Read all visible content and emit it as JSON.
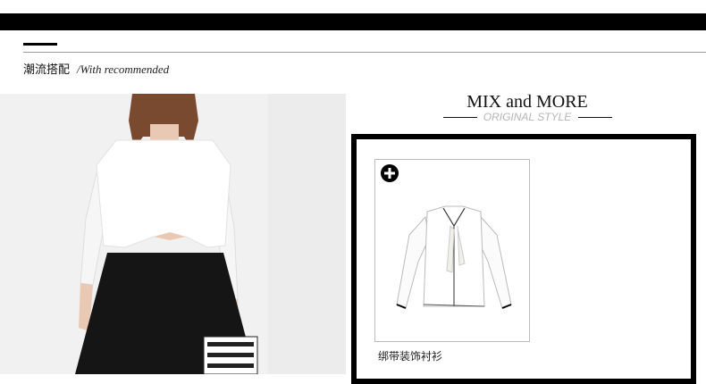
{
  "section": {
    "title": "潮流搭配",
    "subtitle": "/With recommended"
  },
  "mix": {
    "title": "MIX and MORE",
    "subtitle": "ORIGINAL STYLE"
  },
  "product": {
    "name": "绑带装饰衬衫",
    "add_icon": "plus-circle-icon"
  },
  "colors": {
    "bar": "#000000",
    "subtitle_gray": "#b5b5b5",
    "card_border": "#bdbdbd"
  }
}
